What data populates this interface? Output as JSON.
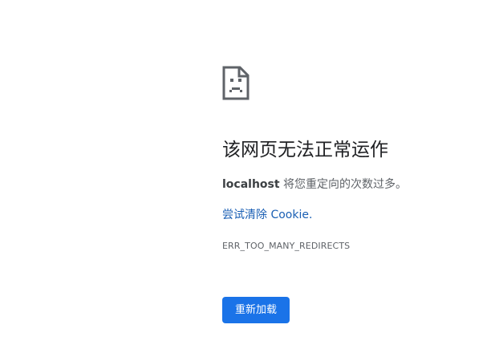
{
  "error": {
    "icon": "sad-page-icon",
    "title": "该网页无法正常运作",
    "host": "localhost",
    "message_rest": " 将您重定向的次数过多。",
    "suggestion_link": "尝试清除 Cookie.",
    "code": "ERR_TOO_MANY_REDIRECTS",
    "reload_label": "重新加载"
  },
  "colors": {
    "accent": "#1a73e8",
    "link": "#1a5fb4",
    "title_text": "#202124",
    "secondary_text": "#5f6368"
  }
}
